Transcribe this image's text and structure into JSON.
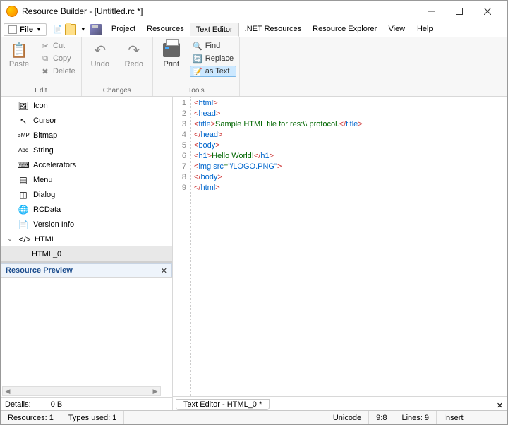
{
  "window": {
    "title": "Resource Builder - [Untitled.rc *]"
  },
  "menu": {
    "file": "File",
    "tabs": [
      "Project",
      "Resources",
      "Text Editor",
      ".NET Resources",
      "Resource Explorer",
      "View",
      "Help"
    ],
    "active": "Text Editor"
  },
  "ribbon": {
    "edit": {
      "label": "Edit",
      "paste": "Paste",
      "cut": "Cut",
      "copy": "Copy",
      "delete": "Delete"
    },
    "changes": {
      "label": "Changes",
      "undo": "Undo",
      "redo": "Redo"
    },
    "tools": {
      "label": "Tools",
      "print": "Print",
      "find": "Find",
      "replace": "Replace",
      "asText": "as Text"
    }
  },
  "tree": {
    "items": [
      {
        "label": "Icon",
        "icon": "🖼"
      },
      {
        "label": "Cursor",
        "icon": "↖"
      },
      {
        "label": "Bitmap",
        "icon": "BMP"
      },
      {
        "label": "String",
        "icon": "Abc"
      },
      {
        "label": "Accelerators",
        "icon": "⌨"
      },
      {
        "label": "Menu",
        "icon": "▤"
      },
      {
        "label": "Dialog",
        "icon": "◫"
      },
      {
        "label": "RCData",
        "icon": "🌐"
      },
      {
        "label": "Version Info",
        "icon": "📄"
      }
    ],
    "html": {
      "label": "HTML",
      "child": "HTML_0"
    }
  },
  "preview": {
    "title": "Resource Preview"
  },
  "details": {
    "label": "Details:",
    "value": "0 B"
  },
  "code": {
    "lines": [
      [
        [
          "brk",
          "<"
        ],
        [
          "tag",
          "html"
        ],
        [
          "brk",
          ">"
        ]
      ],
      [
        [
          "brk",
          "<"
        ],
        [
          "tag",
          "head"
        ],
        [
          "brk",
          ">"
        ]
      ],
      [
        [
          "brk",
          "<"
        ],
        [
          "tag",
          "title"
        ],
        [
          "brk",
          ">"
        ],
        [
          "txt",
          "Sample HTML file for res:\\\\ protocol."
        ],
        [
          "brk",
          "</"
        ],
        [
          "tag",
          "title"
        ],
        [
          "brk",
          ">"
        ]
      ],
      [
        [
          "brk",
          "</"
        ],
        [
          "tag",
          "head"
        ],
        [
          "brk",
          ">"
        ]
      ],
      [
        [
          "brk",
          "<"
        ],
        [
          "tag",
          "body"
        ],
        [
          "brk",
          ">"
        ]
      ],
      [
        [
          "brk",
          "<"
        ],
        [
          "tag",
          "h1"
        ],
        [
          "brk",
          ">"
        ],
        [
          "txt",
          "Hello World!"
        ],
        [
          "brk",
          "</"
        ],
        [
          "tag",
          "h1"
        ],
        [
          "brk",
          ">"
        ]
      ],
      [
        [
          "brk",
          "<"
        ],
        [
          "tag",
          "img src"
        ],
        [
          "txt",
          "="
        ],
        [
          "tag",
          "\"/LOGO.PNG\""
        ],
        [
          "brk",
          ">"
        ]
      ],
      [
        [
          "brk",
          "</"
        ],
        [
          "tag",
          "body"
        ],
        [
          "brk",
          ">"
        ]
      ],
      [
        [
          "brk",
          "</"
        ],
        [
          "tag",
          "html"
        ],
        [
          "brk",
          ">"
        ]
      ]
    ]
  },
  "editorTab": "Text Editor - HTML_0 *",
  "status": {
    "resources": "Resources: 1",
    "types": "Types used: 1",
    "encoding": "Unicode",
    "pos": "9:8",
    "lines": "Lines: 9",
    "mode": "Insert"
  }
}
